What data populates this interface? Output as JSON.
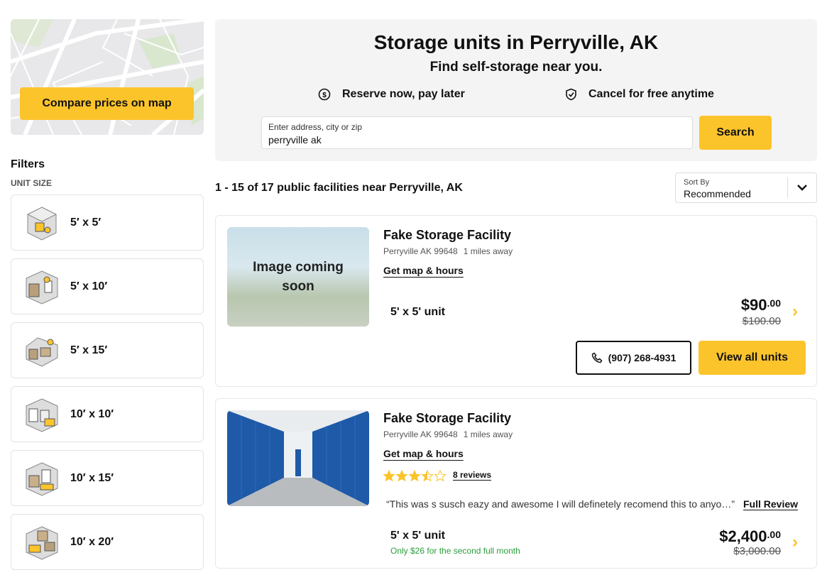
{
  "sidebar": {
    "map_button": "Compare prices on map",
    "filters_title": "Filters",
    "unit_size_label": "UNIT SIZE",
    "sizes": [
      "5′ x 5′",
      "5′ x 10′",
      "5′ x 15′",
      "10′ x 10′",
      "10′ x 15′",
      "10′ x 20′"
    ]
  },
  "hero": {
    "title": "Storage units in Perryville, AK",
    "subtitle": "Find self-storage near you.",
    "perk_reserve": "Reserve now, pay later",
    "perk_cancel": "Cancel for free anytime",
    "search_label": "Enter address, city or zip",
    "search_value": "perryville ak",
    "search_button": "Search"
  },
  "results": {
    "count_text": "1 - 15 of 17 public facilities near Perryville, AK",
    "sort_label": "Sort By",
    "sort_value": "Recommended"
  },
  "facilities": [
    {
      "name": "Fake Storage Facility",
      "address": "Perryville AK 99648",
      "distance": "1 miles away",
      "map_link": "Get map & hours",
      "image_placeholder": "Image coming soon",
      "unit": "5' x 5' unit",
      "price_dollars": "$90",
      "price_cents": ".00",
      "old_price": "$100.00",
      "phone": "(907) 268-4931",
      "view_button": "View all units"
    },
    {
      "name": "Fake Storage Facility",
      "address": "Perryville AK 99648",
      "distance": "1 miles away",
      "map_link": "Get map & hours",
      "rating": 3.5,
      "reviews": "8 reviews",
      "quote": "“This was s susch eazy and awesome I will definetely recomend this to anyo…”",
      "full_review": "Full Review",
      "unit": "5' x 5' unit",
      "promo": "Only $26 for the second full month",
      "price_dollars": "$2,400",
      "price_cents": ".00",
      "old_price": "$3,000.00"
    }
  ],
  "colors": {
    "accent": "#fcc42b",
    "promo": "#2a9d3b"
  }
}
